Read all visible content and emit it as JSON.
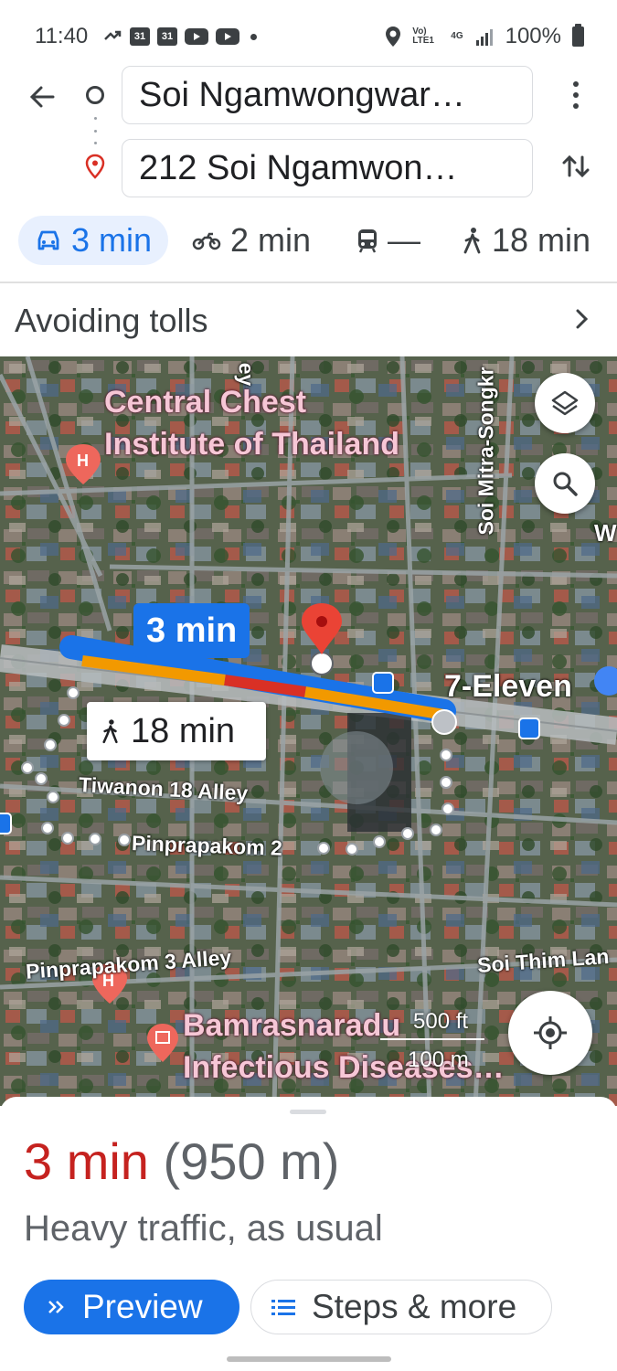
{
  "status_bar": {
    "time": "11:40",
    "left_icons": [
      "missed-call-icon",
      "calendar-31-icon",
      "calendar-31-icon",
      "youtube-icon",
      "youtube-icon",
      "dot-icon"
    ],
    "calendar_label": "31",
    "network_volte": "Vo) LTE1",
    "network_type": "4G",
    "battery": "100%"
  },
  "route": {
    "origin": "Soi Ngamwongwar…",
    "destination": "212 Soi Ngamwon…"
  },
  "modes": [
    {
      "name": "car-icon",
      "label": "3 min",
      "active": true
    },
    {
      "name": "motorcycle-icon",
      "label": "2 min",
      "active": false
    },
    {
      "name": "transit-icon",
      "label": "—",
      "active": false
    },
    {
      "name": "walk-icon",
      "label": "18 min",
      "active": false
    }
  ],
  "options": {
    "avoid_label": "Avoiding tolls"
  },
  "map": {
    "poi_top": "Central Chest\nInstitute of Thailand",
    "poi_top_line1": "Central Chest",
    "poi_top_line2": "Institute of Thailand",
    "poi_seven": "7-Eleven",
    "poi_bottom_line1": "Bamrasnaradu",
    "poi_bottom_line2": "Infectious Diseases…",
    "road_soi_mitra": "Soi Mitra-Songkr",
    "road_tiwanon": "Tiwanon 18 Alley",
    "road_pinprapakom2": "Pinprapakom 2",
    "road_pinprapakom3": "Pinprapakom 3 Alley",
    "road_soi_thim": "Soi Thim Lan",
    "road_partial_ey": "ey",
    "road_partial_w": "W",
    "drive_time": "3 min",
    "walk_time": "18 min",
    "scale_ft": "500 ft",
    "scale_m": "100 m"
  },
  "summary": {
    "eta": "3 min",
    "distance": "(950 m)",
    "traffic": "Heavy traffic, as usual",
    "preview_label": "Preview",
    "steps_label": "Steps & more"
  },
  "colors": {
    "accent": "#1a73e8",
    "eta_red": "#c5221f",
    "route_orange": "#f29900",
    "route_red": "#d93025"
  }
}
